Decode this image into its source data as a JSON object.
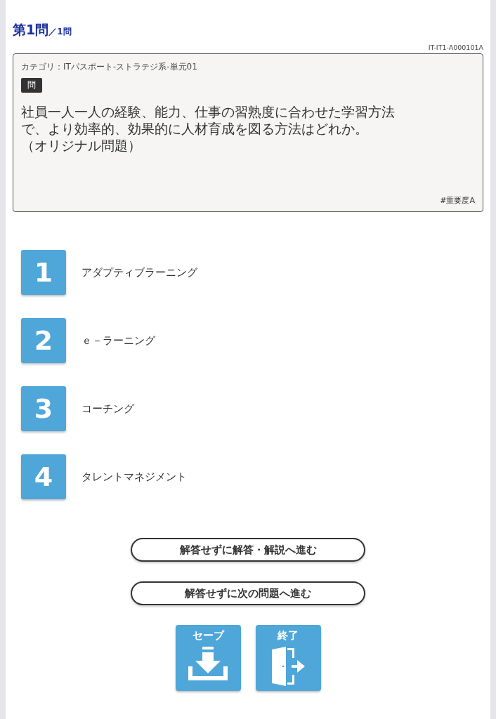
{
  "header": {
    "title": "第1問",
    "total": "／1問",
    "question_id": "IT-IT1-A000101A"
  },
  "question": {
    "category": "カテゴリ：ITパスポート-ストラテジ系-単元01",
    "badge": "問",
    "lines": [
      "社員一人一人の経験、能力、仕事の習熟度に合わせた学習方法",
      "で、より効率的、効果的に人材育成を図る方法はどれか。",
      "（オリジナル問題）"
    ],
    "tag": "#重要度A"
  },
  "choices": [
    {
      "number": "1",
      "label": "アダプティブラーニング"
    },
    {
      "number": "2",
      "label": "ｅ－ラーニング"
    },
    {
      "number": "3",
      "label": "コーチング"
    },
    {
      "number": "4",
      "label": "タレントマネジメント"
    }
  ],
  "buttons": [
    "解答せずに解答・解説へ進む",
    "解答せずに次の問題へ進む"
  ],
  "actions": [
    {
      "kind": "save",
      "label": "セーブ"
    },
    {
      "kind": "exit",
      "label": "終了"
    }
  ]
}
